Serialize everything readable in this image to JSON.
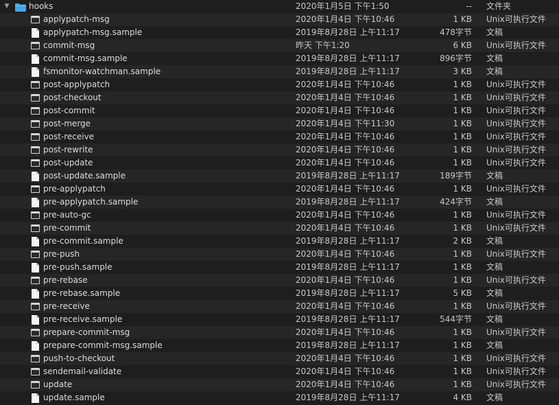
{
  "colors": {
    "background": "#1e1e1e",
    "alt_row": "#262626",
    "folder": "#41a6e6",
    "text": "#dcdcdc"
  },
  "folder": {
    "disclosure": "▼",
    "icon": "folder-icon",
    "name": "hooks",
    "date": "2020年1月5日 下午1:50",
    "size": "--",
    "kind": "文件夹"
  },
  "files": [
    {
      "icon": "exec-icon",
      "name": "applypatch-msg",
      "date": "2020年1月4日 下午10:46",
      "size": "1 KB",
      "kind": "Unix可执行文件"
    },
    {
      "icon": "doc-icon",
      "name": "applypatch-msg.sample",
      "date": "2019年8月28日 上午11:17",
      "size": "478字节",
      "kind": "文稿"
    },
    {
      "icon": "exec-icon",
      "name": "commit-msg",
      "date": "昨天 下午1:20",
      "size": "6 KB",
      "kind": "Unix可执行文件"
    },
    {
      "icon": "doc-icon",
      "name": "commit-msg.sample",
      "date": "2019年8月28日 上午11:17",
      "size": "896字节",
      "kind": "文稿"
    },
    {
      "icon": "doc-icon",
      "name": "fsmonitor-watchman.sample",
      "date": "2019年8月28日 上午11:17",
      "size": "3 KB",
      "kind": "文稿"
    },
    {
      "icon": "exec-icon",
      "name": "post-applypatch",
      "date": "2020年1月4日 下午10:46",
      "size": "1 KB",
      "kind": "Unix可执行文件"
    },
    {
      "icon": "exec-icon",
      "name": "post-checkout",
      "date": "2020年1月4日 下午10:46",
      "size": "1 KB",
      "kind": "Unix可执行文件"
    },
    {
      "icon": "exec-icon",
      "name": "post-commit",
      "date": "2020年1月4日 下午10:46",
      "size": "1 KB",
      "kind": "Unix可执行文件"
    },
    {
      "icon": "exec-icon",
      "name": "post-merge",
      "date": "2020年1月4日 下午11:30",
      "size": "1 KB",
      "kind": "Unix可执行文件"
    },
    {
      "icon": "exec-icon",
      "name": "post-receive",
      "date": "2020年1月4日 下午10:46",
      "size": "1 KB",
      "kind": "Unix可执行文件"
    },
    {
      "icon": "exec-icon",
      "name": "post-rewrite",
      "date": "2020年1月4日 下午10:46",
      "size": "1 KB",
      "kind": "Unix可执行文件"
    },
    {
      "icon": "exec-icon",
      "name": "post-update",
      "date": "2020年1月4日 下午10:46",
      "size": "1 KB",
      "kind": "Unix可执行文件"
    },
    {
      "icon": "doc-icon",
      "name": "post-update.sample",
      "date": "2019年8月28日 上午11:17",
      "size": "189字节",
      "kind": "文稿"
    },
    {
      "icon": "exec-icon",
      "name": "pre-applypatch",
      "date": "2020年1月4日 下午10:46",
      "size": "1 KB",
      "kind": "Unix可执行文件"
    },
    {
      "icon": "doc-icon",
      "name": "pre-applypatch.sample",
      "date": "2019年8月28日 上午11:17",
      "size": "424字节",
      "kind": "文稿"
    },
    {
      "icon": "exec-icon",
      "name": "pre-auto-gc",
      "date": "2020年1月4日 下午10:46",
      "size": "1 KB",
      "kind": "Unix可执行文件"
    },
    {
      "icon": "exec-icon",
      "name": "pre-commit",
      "date": "2020年1月4日 下午10:46",
      "size": "1 KB",
      "kind": "Unix可执行文件"
    },
    {
      "icon": "doc-icon",
      "name": "pre-commit.sample",
      "date": "2019年8月28日 上午11:17",
      "size": "2 KB",
      "kind": "文稿"
    },
    {
      "icon": "exec-icon",
      "name": "pre-push",
      "date": "2020年1月4日 下午10:46",
      "size": "1 KB",
      "kind": "Unix可执行文件"
    },
    {
      "icon": "doc-icon",
      "name": "pre-push.sample",
      "date": "2019年8月28日 上午11:17",
      "size": "1 KB",
      "kind": "文稿"
    },
    {
      "icon": "exec-icon",
      "name": "pre-rebase",
      "date": "2020年1月4日 下午10:46",
      "size": "1 KB",
      "kind": "Unix可执行文件"
    },
    {
      "icon": "doc-icon",
      "name": "pre-rebase.sample",
      "date": "2019年8月28日 上午11:17",
      "size": "5 KB",
      "kind": "文稿"
    },
    {
      "icon": "exec-icon",
      "name": "pre-receive",
      "date": "2020年1月4日 下午10:46",
      "size": "1 KB",
      "kind": "Unix可执行文件"
    },
    {
      "icon": "doc-icon",
      "name": "pre-receive.sample",
      "date": "2019年8月28日 上午11:17",
      "size": "544字节",
      "kind": "文稿"
    },
    {
      "icon": "exec-icon",
      "name": "prepare-commit-msg",
      "date": "2020年1月4日 下午10:46",
      "size": "1 KB",
      "kind": "Unix可执行文件"
    },
    {
      "icon": "doc-icon",
      "name": "prepare-commit-msg.sample",
      "date": "2019年8月28日 上午11:17",
      "size": "1 KB",
      "kind": "文稿"
    },
    {
      "icon": "exec-icon",
      "name": "push-to-checkout",
      "date": "2020年1月4日 下午10:46",
      "size": "1 KB",
      "kind": "Unix可执行文件"
    },
    {
      "icon": "exec-icon",
      "name": "sendemail-validate",
      "date": "2020年1月4日 下午10:46",
      "size": "1 KB",
      "kind": "Unix可执行文件"
    },
    {
      "icon": "exec-icon",
      "name": "update",
      "date": "2020年1月4日 下午10:46",
      "size": "1 KB",
      "kind": "Unix可执行文件"
    },
    {
      "icon": "doc-icon",
      "name": "update.sample",
      "date": "2019年8月28日 上午11:17",
      "size": "4 KB",
      "kind": "文稿"
    }
  ]
}
